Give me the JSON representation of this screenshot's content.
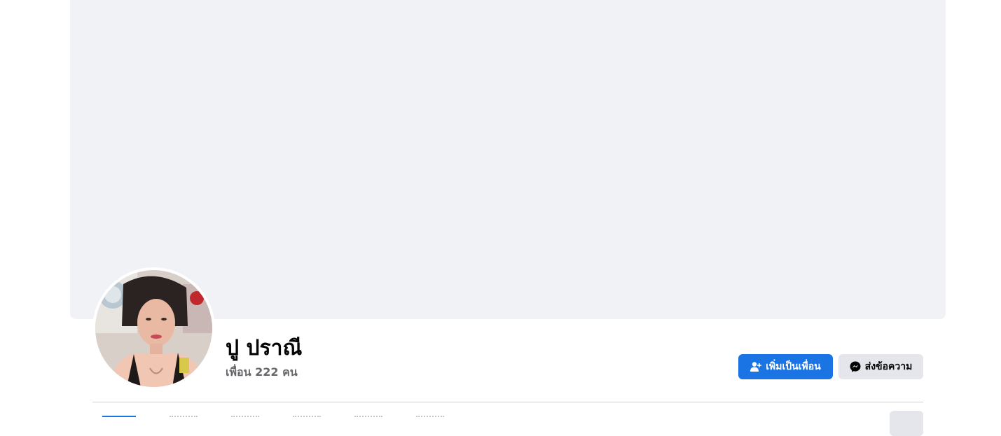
{
  "profile": {
    "name": "ปู ปราณี",
    "friends_text": "เพื่อน 222 คน"
  },
  "actions": {
    "add_friend_label": "เพิ่มเป็นเพื่อน",
    "message_label": "ส่งข้อความ"
  },
  "icons": {
    "add_friend": "add-friend-icon",
    "message": "messenger-icon"
  },
  "colors": {
    "primary_button": "#1b74e4",
    "secondary_button": "#e4e6eb",
    "cover_placeholder": "#f0f2f5",
    "muted_text": "#65676b"
  }
}
